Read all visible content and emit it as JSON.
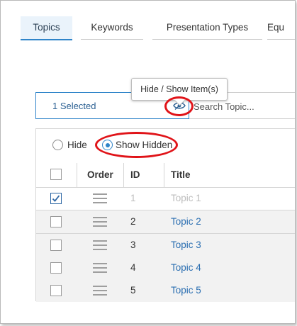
{
  "tabs": [
    {
      "label": "Topics"
    },
    {
      "label": "Keywords"
    },
    {
      "label": "Presentation Types"
    },
    {
      "label": "Equ"
    }
  ],
  "tooltip": {
    "text": "Hide / Show Item(s)"
  },
  "selector": {
    "value": "1 Selected"
  },
  "search": {
    "placeholder": "Search Topic..."
  },
  "visibility": {
    "hide_label": "Hide",
    "show_hidden_label": "Show Hidden",
    "selected": "Show Hidden"
  },
  "table": {
    "columns": [
      "Order",
      "ID",
      "Title"
    ],
    "rows": [
      {
        "id": "1",
        "title": "Topic 1",
        "checked": true,
        "hidden": true
      },
      {
        "id": "2",
        "title": "Topic 2",
        "checked": false,
        "hidden": false
      },
      {
        "id": "3",
        "title": "Topic 3",
        "checked": false,
        "hidden": false
      },
      {
        "id": "4",
        "title": "Topic 4",
        "checked": false,
        "hidden": false
      },
      {
        "id": "5",
        "title": "Topic 5",
        "checked": false,
        "hidden": false
      }
    ]
  },
  "icons": {
    "visibility_toggle": "eye-slash-icon",
    "row_drag": "drag-handle-icon",
    "check": "check-icon"
  },
  "colors": {
    "accent": "#2f84c9",
    "link": "#2a6eb1",
    "annotation": "#e01318",
    "muted_text": "#bdbdbd",
    "alt_row": "#f2f2f2"
  }
}
